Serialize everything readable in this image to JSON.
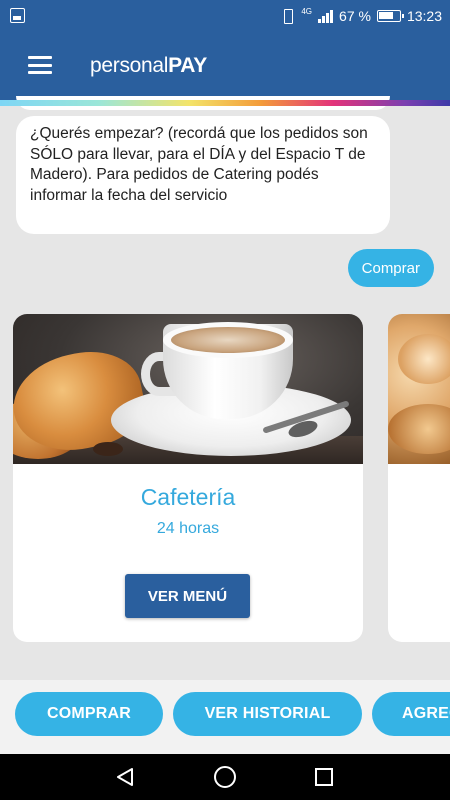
{
  "status_bar": {
    "network": "4G",
    "battery_percent": "67 %",
    "time": "13:23"
  },
  "app_bar": {
    "brand_light": "personal",
    "brand_bold": "PAY"
  },
  "chat": {
    "message": "¿Querés empezar? (recordá que los pedidos son SÓLO para llevar, para el DÍA y del Espacio T de Madero). Para pedidos de Catering podés informar la fecha del servicio",
    "comprar_label": "Comprar"
  },
  "cards": [
    {
      "title": "Cafetería",
      "subtitle": "24 horas",
      "button_label": "VER MENÚ"
    }
  ],
  "bottom_actions": {
    "comprar": "COMPRAR",
    "ver_historial": "VER HISTORIAL",
    "agregar": "AGREG"
  },
  "colors": {
    "primary": "#2a5f9e",
    "accent": "#35b3e5",
    "background": "#e6e6e6"
  }
}
